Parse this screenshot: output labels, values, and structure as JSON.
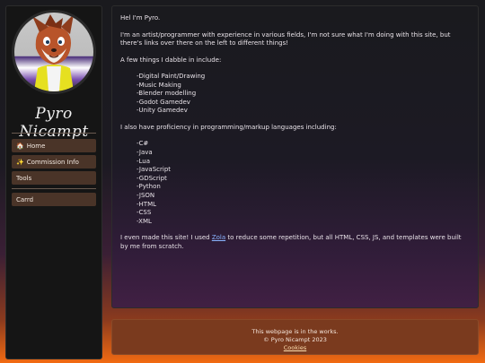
{
  "sidebar": {
    "title": "Pyro Nicampt",
    "nav": [
      {
        "icon": "house-icon",
        "glyph": "🏠",
        "label": "Home"
      },
      {
        "icon": "sparkle-icon",
        "glyph": "✨",
        "label": "Commission Info"
      },
      {
        "icon": "",
        "glyph": "",
        "label": "Tools"
      }
    ],
    "links": [
      {
        "label": "Carrd"
      }
    ]
  },
  "main": {
    "greeting": "Hel I'm Pyro.",
    "intro": "I'm an artist/programmer with experience in various fields, I'm not sure what I'm doing with this site, but there's links over there on the left to different things!",
    "dabble_heading": "A few things I dabble in include:",
    "dabble_list": [
      "-Digital Paint/Drawing",
      "-Music Making",
      "-Blender modelling",
      "-Godot Gamedev",
      "-Unity Gamedev"
    ],
    "lang_heading": "I also have proficiency in programming/markup languages including:",
    "lang_list": [
      "-C#",
      "-Java",
      "-Lua",
      "-JavaScript",
      "-GDScript",
      "-Python",
      "-JSON",
      "-HTML",
      "-CSS",
      "-XML"
    ],
    "closing_before": "I even made this site! I used ",
    "closing_link": "Zola",
    "closing_after": " to reduce some repetition, but all HTML, CSS, JS, and templates were built by me from scratch."
  },
  "footer": {
    "line1": "This webpage is in the works.",
    "line2": "© Pyro Nicampt 2023",
    "cookies": "Cookies"
  },
  "colors": {
    "nav_bg": "#4a3428",
    "footer_bg": "#7a3a1e",
    "link": "#8ab4ff",
    "gradient_bottom": "#f26a12"
  }
}
